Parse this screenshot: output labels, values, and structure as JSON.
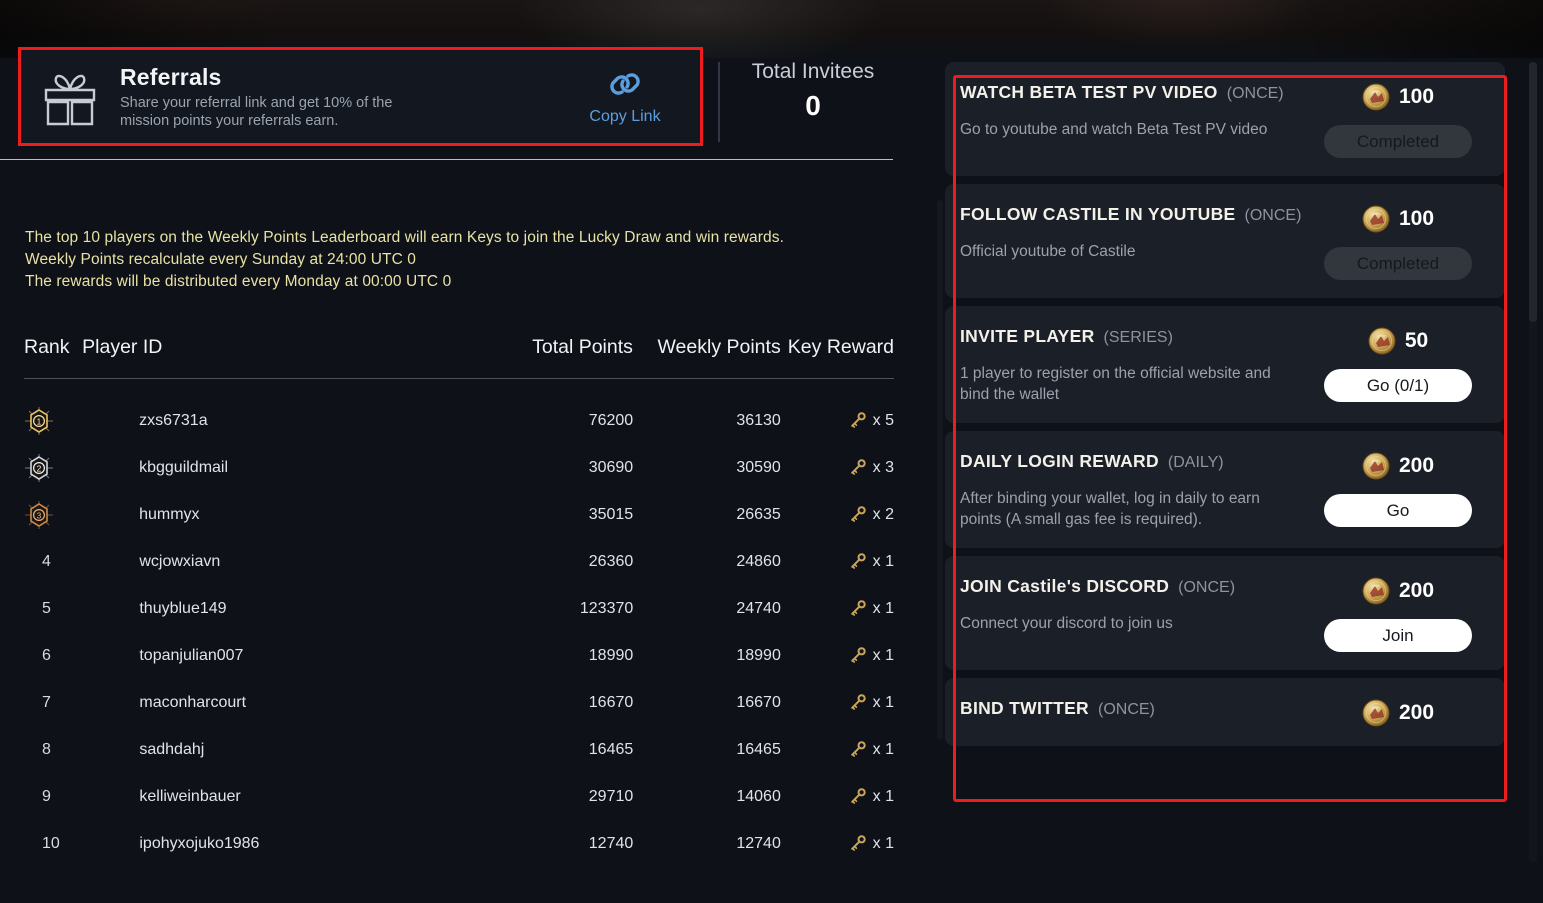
{
  "referral": {
    "icon": "gift-icon",
    "title": "Referrals",
    "subtitle_line1": "Share your referral link and get 10% of the",
    "subtitle_line2": "mission points your referrals earn.",
    "copy_link_label": "Copy Link",
    "copy_link_icon": "link-icon"
  },
  "invitees": {
    "title": "Total Invitees",
    "value": "0"
  },
  "notice": {
    "line1": "The top 10 players on the Weekly Points Leaderboard will earn Keys to join the Lucky Draw and win rewards.",
    "line2": "Weekly Points recalculate every Sunday at 24:00 UTC 0",
    "line3": "The rewards will be distributed every Monday at 00:00 UTC 0",
    "color": "#e8e2a5"
  },
  "leaderboard": {
    "columns": [
      "Rank",
      "Player ID",
      "Total Points",
      "Weekly Points",
      "Key Reward"
    ],
    "rows": [
      {
        "rank": "1",
        "medal": "gold",
        "player": "zxs6731a",
        "total": "76200",
        "weekly": "36130",
        "key": "x 5"
      },
      {
        "rank": "2",
        "medal": "silver",
        "player": "kbgguildmail",
        "total": "30690",
        "weekly": "30590",
        "key": "x 3"
      },
      {
        "rank": "3",
        "medal": "bronze",
        "player": "hummyx",
        "total": "35015",
        "weekly": "26635",
        "key": "x 2"
      },
      {
        "rank": "4",
        "medal": "",
        "player": "wcjowxiavn",
        "total": "26360",
        "weekly": "24860",
        "key": "x 1"
      },
      {
        "rank": "5",
        "medal": "",
        "player": "thuyblue149",
        "total": "123370",
        "weekly": "24740",
        "key": "x 1"
      },
      {
        "rank": "6",
        "medal": "",
        "player": "topanjulian007",
        "total": "18990",
        "weekly": "18990",
        "key": "x 1"
      },
      {
        "rank": "7",
        "medal": "",
        "player": "maconharcourt",
        "total": "16670",
        "weekly": "16670",
        "key": "x 1"
      },
      {
        "rank": "8",
        "medal": "",
        "player": "sadhdahj",
        "total": "16465",
        "weekly": "16465",
        "key": "x 1"
      },
      {
        "rank": "9",
        "medal": "",
        "player": "kelliweinbauer",
        "total": "29710",
        "weekly": "14060",
        "key": "x 1"
      },
      {
        "rank": "10",
        "medal": "",
        "player": "ipohyxojuko1986",
        "total": "12740",
        "weekly": "12740",
        "key": "x 1"
      }
    ]
  },
  "missions": [
    {
      "title": "WATCH BETA TEST PV VIDEO",
      "freq": "(ONCE)",
      "desc": "Go to youtube and watch Beta Test PV video",
      "points": "100",
      "button_label": "Completed",
      "button_state": "done"
    },
    {
      "title": "FOLLOW CASTILE IN YOUTUBE",
      "freq": "(ONCE)",
      "desc": "Official youtube of Castile",
      "points": "100",
      "button_label": "Completed",
      "button_state": "done"
    },
    {
      "title": "INVITE PLAYER",
      "freq": "(SERIES)",
      "desc": "1 player to register on the official website and bind the wallet",
      "points": "50",
      "button_label": "Go (0/1)",
      "button_state": "go"
    },
    {
      "title": "DAILY LOGIN REWARD",
      "freq": "(DAILY)",
      "desc": "After binding your wallet, log in daily to earn points (A small gas fee is required).",
      "points": "200",
      "button_label": "Go",
      "button_state": "go"
    },
    {
      "title": "JOIN Castile's DISCORD",
      "freq": "(ONCE)",
      "desc": "Connect your discord to join us",
      "points": "200",
      "button_label": "Join",
      "button_state": "go"
    },
    {
      "title": "BIND TWITTER",
      "freq": "(ONCE)",
      "desc": "",
      "points": "200",
      "button_label": "",
      "button_state": "none"
    }
  ],
  "highlight_color": "#ee1c1c"
}
